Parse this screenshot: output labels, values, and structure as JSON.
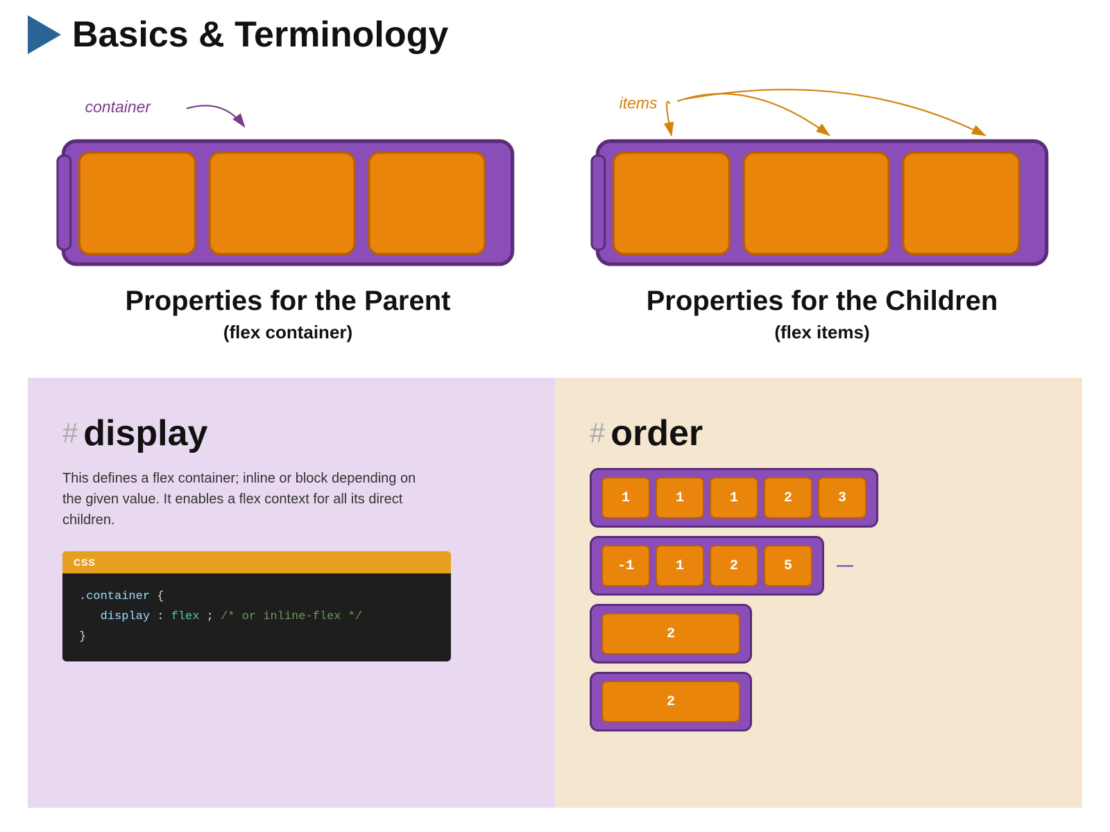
{
  "header": {
    "title": "Basics & Terminology",
    "play_icon_alt": "play-icon"
  },
  "diagrams": {
    "left": {
      "label": "container",
      "prop_title": "Properties for the Parent",
      "prop_subtitle": "(flex container)"
    },
    "right": {
      "label": "items",
      "prop_title": "Properties for the Children",
      "prop_subtitle": "(flex items)"
    }
  },
  "panel_left": {
    "hash": "#",
    "title": "display",
    "description": "This defines a flex container; inline or block depending on the given value. It enables a flex context for all its direct children.",
    "code_header": "CSS",
    "code_lines": [
      ".container {",
      "  display: flex; /* or inline-flex */",
      "}"
    ]
  },
  "panel_right": {
    "hash": "#",
    "title": "order",
    "order_rows": [
      {
        "items": [
          "1",
          "1",
          "1",
          "2",
          "3"
        ],
        "dash": ""
      },
      {
        "items": [
          "-1",
          "1",
          "2",
          "5"
        ],
        "dash": "—"
      },
      {
        "items": [
          "2"
        ],
        "wide": true,
        "dash": ""
      },
      {
        "items": [
          "2"
        ],
        "wide": true,
        "dash": ""
      }
    ]
  },
  "colors": {
    "purple_container": "#8b4db8",
    "purple_border": "#5a2d7a",
    "orange_item": "#e8850a",
    "orange_border": "#b86000",
    "label_purple": "#7c3a8c",
    "label_orange": "#d4820a",
    "panel_left_bg": "#e8d9f0",
    "panel_right_bg": "#f5e6d0"
  }
}
